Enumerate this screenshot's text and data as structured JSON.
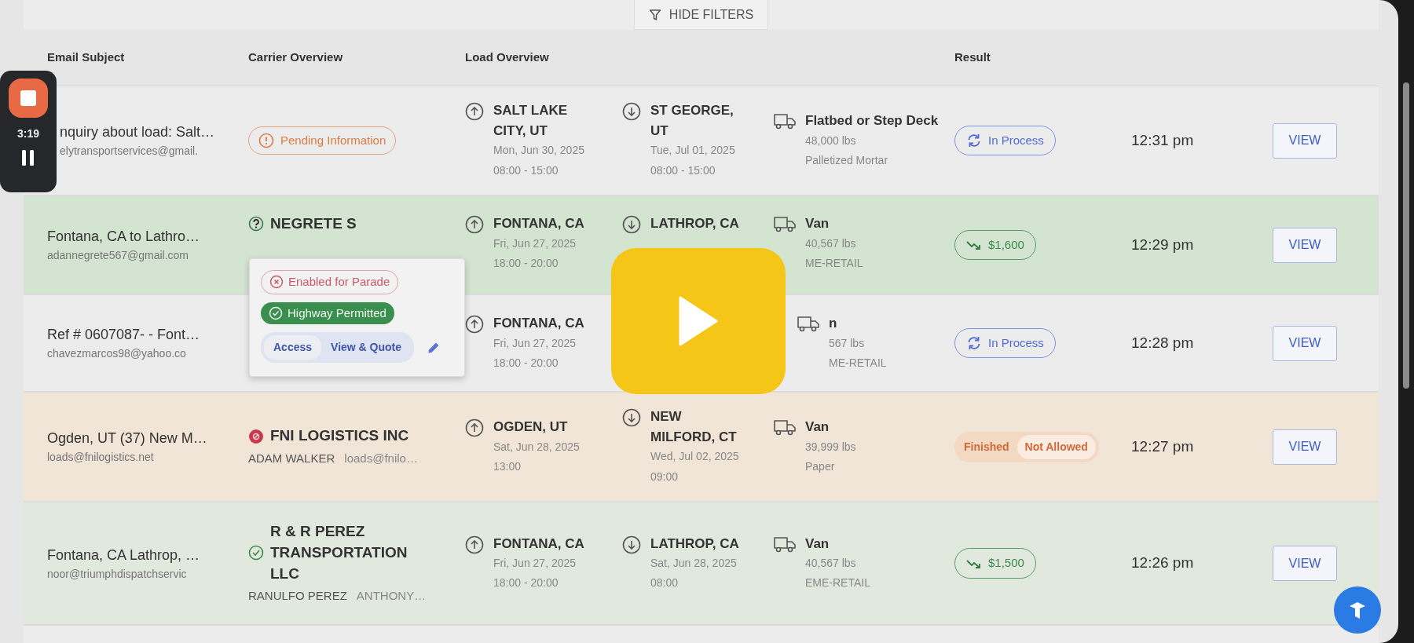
{
  "toolbar": {
    "filter_button": "HIDE FILTERS"
  },
  "recorder": {
    "time": "3:19"
  },
  "columns": [
    "Email Subject",
    "Carrier Overview",
    "Load Overview",
    "Result"
  ],
  "rows": [
    {
      "subject": "nquiry about load: Salt…",
      "email": "elytransportservices@gmail.",
      "carrier": {
        "kind": "badge",
        "label": "Pending Information"
      },
      "pickup": {
        "city": "SALT LAKE CITY, UT",
        "date": "Mon, Jun 30, 2025",
        "time": "08:00 - 15:00"
      },
      "drop": {
        "city": "ST GEORGE, UT",
        "date": "Tue, Jul 01, 2025",
        "time": "08:00 - 15:00"
      },
      "equipment": {
        "type": "Flatbed or Step Deck",
        "weight": "48,000 lbs",
        "commodity": "Palletized Mortar"
      },
      "result": {
        "kind": "in_process",
        "label": "In Process"
      },
      "received": "12:31 pm",
      "action": "VIEW"
    },
    {
      "color": "#d3e4d0",
      "subject": "Fontana, CA to Lathro…",
      "email": "adannegrete567@gmail.com",
      "carrier": {
        "kind": "carrier",
        "icon": {
          "kind": "question"
        },
        "name": "NEGRETE S"
      },
      "pickup": {
        "city": "FONTANA, CA",
        "date": "Fri, Jun 27, 2025",
        "time": "18:00 - 20:00"
      },
      "drop": {
        "city": "LATHROP, CA"
      },
      "equipment": {
        "type": "Van",
        "weight": "40,567 lbs",
        "commodity": "ME-RETAIL"
      },
      "result": {
        "kind": "price",
        "label": "$1,600"
      },
      "received": "12:29 pm",
      "action": "VIEW"
    },
    {
      "subject": "Ref # 0607087- - Font…",
      "email": "chavezmarcos98@yahoo.co",
      "pickup": {
        "city": "FONTANA, CA",
        "date": "Fri, Jun 27, 2025",
        "time": "18:00 - 20:00"
      },
      "equipment": {
        "type": "n",
        "weight": "567 lbs",
        "commodity": "ME-RETAIL"
      },
      "result": {
        "kind": "in_process",
        "label": "In Process"
      },
      "received": "12:28 pm",
      "action": "VIEW"
    },
    {
      "color": "#f0e5d7",
      "subject": "Ogden, UT (37) New M…",
      "email": "loads@fnilogistics.net",
      "carrier": {
        "kind": "carrier",
        "icon": {
          "kind": "blocked"
        },
        "name": "FNI LOGISTICS INC",
        "contacts": [
          "ADAM WALKER",
          "loads@fnilo…"
        ]
      },
      "pickup": {
        "city": "OGDEN, UT",
        "date": "Sat, Jun 28, 2025",
        "time": "13:00"
      },
      "drop": {
        "city": "NEW MILFORD, CT",
        "date": "Wed, Jul 02, 2025",
        "time": "09:00"
      },
      "equipment": {
        "type": "Van",
        "weight": "39,999 lbs",
        "commodity": "Paper"
      },
      "result": {
        "kind": "finished",
        "label": "Finished",
        "detail": "Not Allowed"
      },
      "received": "12:27 pm",
      "action": "VIEW"
    },
    {
      "color": "#e1e9df",
      "subject": "Fontana, CA Lathrop, …",
      "email": "noor@triumphdispatchservic",
      "carrier": {
        "kind": "carrier",
        "icon": {
          "kind": "verified"
        },
        "name": "R & R PEREZ TRANSPORTATION LLC",
        "contacts": [
          "RANULFO PEREZ",
          "ANTHONY…"
        ]
      },
      "pickup": {
        "city": "FONTANA, CA",
        "date": "Fri, Jun 27, 2025",
        "time": "18:00 - 20:00"
      },
      "drop": {
        "city": "LATHROP, CA",
        "date": "Sat, Jun 28, 2025",
        "time": "08:00"
      },
      "equipment": {
        "type": "Van",
        "weight": "40,567 lbs",
        "commodity": "EME-RETAIL"
      },
      "result": {
        "kind": "price",
        "label": "$1,500"
      },
      "received": "12:26 pm",
      "action": "VIEW"
    }
  ],
  "popup": {
    "tags": [
      {
        "kind": "disabled",
        "label": "Enabled for Parade"
      },
      {
        "kind": "enabled",
        "label": "Highway Permitted"
      }
    ],
    "segments": [
      {
        "label": "Access",
        "selected": true
      },
      {
        "label": "View & Quote",
        "selected": false
      }
    ]
  }
}
